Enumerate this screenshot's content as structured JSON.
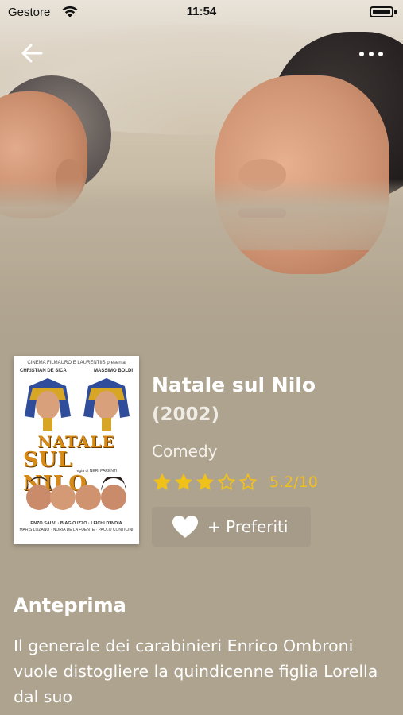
{
  "status_bar": {
    "carrier": "Gestore",
    "time": "11:54"
  },
  "nav": {
    "back_icon": "arrow-left-icon",
    "more_icon": "more-horizontal-icon"
  },
  "poster": {
    "top_text": "CINEMA FILMAURO E LAURENTIIS presenta",
    "actor_left": "CHRISTIAN DE SICA",
    "actor_right": "MASSIMO BOLDI",
    "title_line1": "NATALE",
    "title_line2": "SUL NILO",
    "credit": "regia di NERI PARENTI",
    "cast_line1": "ENZO SALVI · BIAGIO IZZO · I FICHI D'INDIA",
    "cast_line2": "MARIS LOZANO · NORIA DE LA FUENTE · PAOLO CONTICINI"
  },
  "movie": {
    "title": "Natale sul Nilo",
    "year": "(2002)",
    "genre": "Comedy",
    "rating_stars": 2.6,
    "rating_text": "5.2/10",
    "star_color": "#f1c11b"
  },
  "favorite": {
    "label": "+ Preferiti",
    "icon": "heart-icon"
  },
  "overview": {
    "heading": "Anteprima",
    "text": "Il generale dei carabinieri Enrico Ombroni vuole distogliere la quindicenne figlia Lorella dal suo"
  },
  "colors": {
    "background": "#aea38f",
    "text": "#ffffff",
    "accent": "#f1c11b"
  }
}
